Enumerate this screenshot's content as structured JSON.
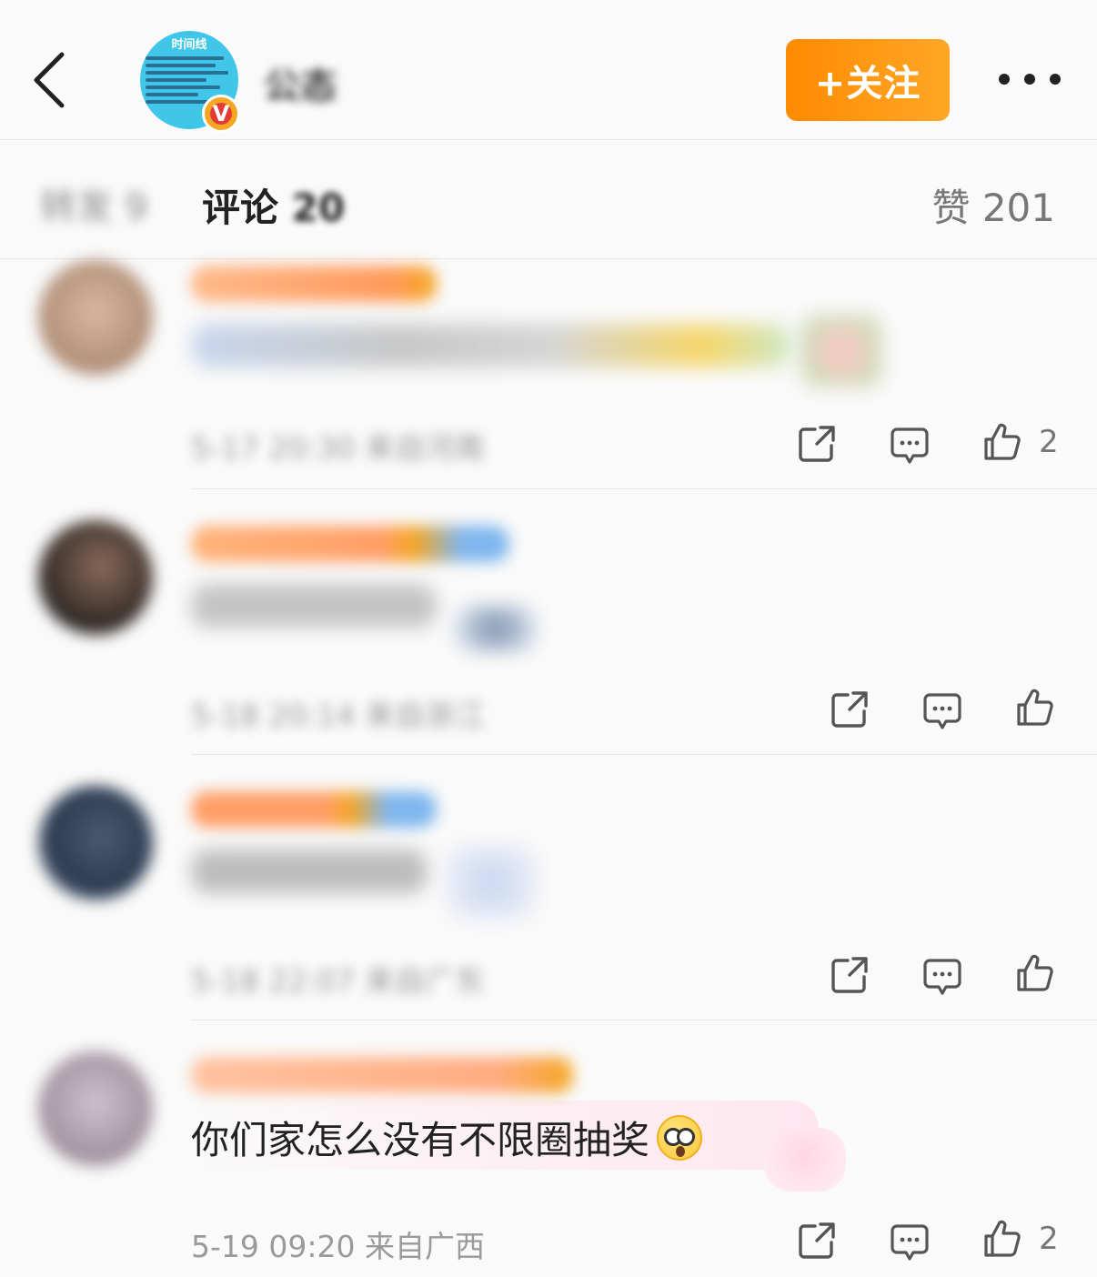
{
  "header": {
    "back_icon": "chevron-left-icon",
    "avatar_title": "时间线",
    "verified_badge": "V",
    "username": "公态",
    "follow_label": "+关注",
    "more_icon": "ellipsis-icon"
  },
  "tabs": {
    "repost_label": "转发 9",
    "comment_label": "评论",
    "comment_count": "20",
    "like_label": "赞 201"
  },
  "comments": [
    {
      "meta": "5-17 20:30 来自河南",
      "like_count": "2"
    },
    {
      "meta": "5-18 20:14 来自浙江",
      "like_count": ""
    },
    {
      "meta": "5-18 22:07 来自广东",
      "like_count": ""
    },
    {
      "text": "你们家怎么没有不限圈抽奖",
      "meta": "5-19 09:20 来自广西",
      "like_count": "2"
    }
  ],
  "colors": {
    "follow_button": "#ff8a00",
    "background": "#fafafa",
    "meta_text": "#9a9a9a"
  }
}
